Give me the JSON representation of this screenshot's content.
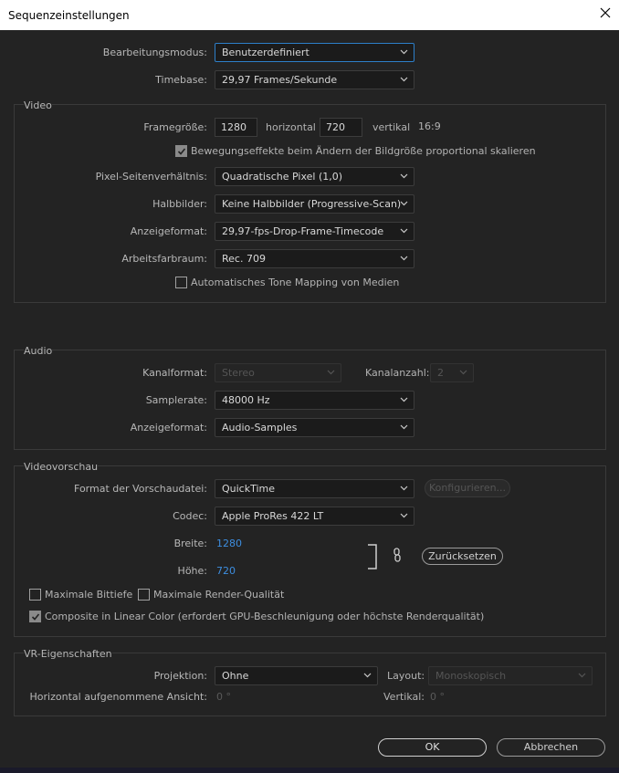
{
  "window": {
    "title": "Sequenzeinstellungen"
  },
  "general": {
    "edit_mode_label": "Bearbeitungsmodus:",
    "edit_mode_value": "Benutzerdefiniert",
    "timebase_label": "Timebase:",
    "timebase_value": "29,97  Frames/Sekunde"
  },
  "video": {
    "section_title": "Video",
    "frame_size_label": "Framegröße:",
    "frame_width": "1280",
    "horizontal_label": "horizontal",
    "frame_height": "720",
    "vertical_label": "vertikal",
    "aspect": "16:9",
    "scale_motion_checkbox": "Bewegungseffekte beim Ändern der Bildgröße proportional skalieren",
    "scale_motion_checked": true,
    "pixel_aspect_label": "Pixel-Seitenverhältnis:",
    "pixel_aspect_value": "Quadratische Pixel (1,0)",
    "fields_label": "Halbbilder:",
    "fields_value": "Keine Halbbilder (Progressive-Scan)",
    "display_format_label": "Anzeigeformat:",
    "display_format_value": "29,97-fps-Drop-Frame-Timecode",
    "color_space_label": "Arbeitsfarbraum:",
    "color_space_value": "Rec. 709",
    "tone_mapping_checkbox": "Automatisches Tone Mapping von Medien",
    "tone_mapping_checked": false
  },
  "audio": {
    "section_title": "Audio",
    "channel_format_label": "Kanalformat:",
    "channel_format_value": "Stereo",
    "channel_count_label": "Kanalanzahl:",
    "channel_count_value": "2",
    "sample_rate_label": "Samplerate:",
    "sample_rate_value": "48000 Hz",
    "display_format_label": "Anzeigeformat:",
    "display_format_value": "Audio-Samples"
  },
  "preview": {
    "section_title": "Videovorschau",
    "file_format_label": "Format der Vorschaudatei:",
    "file_format_value": "QuickTime",
    "configure_button": "Konfigurieren...",
    "codec_label": "Codec:",
    "codec_value": "Apple ProRes 422 LT",
    "width_label": "Breite:",
    "width_value": "1280",
    "height_label": "Höhe:",
    "height_value": "720",
    "reset_button": "Zurücksetzen",
    "max_bit_depth": "Maximale Bittiefe",
    "max_bit_depth_checked": false,
    "max_render_quality": "Maximale Render-Qualität",
    "max_render_quality_checked": false,
    "linear_color": "Composite in Linear Color (erfordert GPU-Beschleunigung oder höchste Renderqualität)",
    "linear_color_checked": true
  },
  "vr": {
    "section_title": "VR-Eigenschaften",
    "projection_label": "Projektion:",
    "projection_value": "Ohne",
    "layout_label": "Layout:",
    "layout_value": "Monoskopisch",
    "h_view_label": "Horizontal aufgenommene Ansicht:",
    "h_view_value": "0 °",
    "v_label": "Vertikal:",
    "v_value": "0 °"
  },
  "buttons": {
    "ok": "OK",
    "cancel": "Abbrechen"
  },
  "colors": {
    "accent": "#2d7fc9",
    "link_value": "#3d8ee0",
    "background": "#232323"
  }
}
